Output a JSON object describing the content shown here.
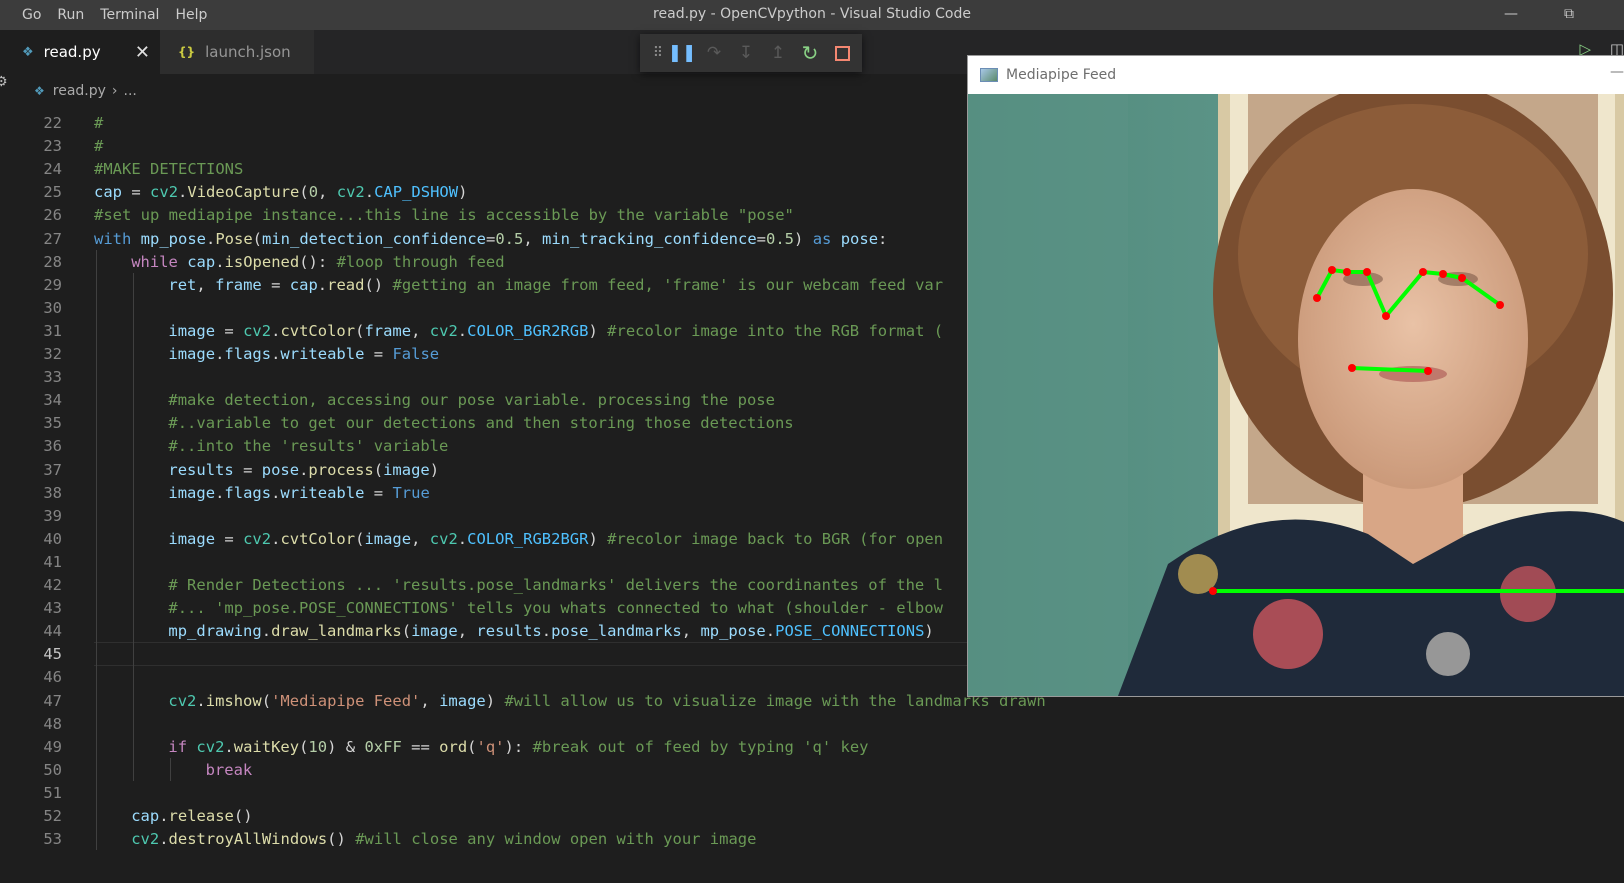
{
  "titlebar": {
    "menu": [
      "Go",
      "Run",
      "Terminal",
      "Help"
    ],
    "title": "read.py - OpenCVpython - Visual Studio Code"
  },
  "tabs": [
    {
      "label": "read.py",
      "icon": "python-file-icon",
      "active": true
    },
    {
      "label": "launch.json",
      "icon": "json-braces-icon",
      "active": false
    }
  ],
  "breadcrumb": {
    "file": "read.py",
    "rest": "..."
  },
  "code": {
    "active_line": 45,
    "lines": [
      {
        "n": "22",
        "text": "#"
      },
      {
        "n": "23",
        "text": "#"
      },
      {
        "n": "24",
        "text": "#MAKE DETECTIONS"
      },
      {
        "n": "25",
        "text": "cap = cv2.VideoCapture(0, cv2.CAP_DSHOW)"
      },
      {
        "n": "26",
        "text": "#set up mediapipe instance...this line is accessible by the variable \"pose\""
      },
      {
        "n": "27",
        "text": "with mp_pose.Pose(min_detection_confidence=0.5, min_tracking_confidence=0.5) as pose:"
      },
      {
        "n": "28",
        "text": "while cap.isOpened(): #loop through feed"
      },
      {
        "n": "29",
        "text": "ret, frame = cap.read() #getting an image from feed, 'frame' is our webcam feed var"
      },
      {
        "n": "30",
        "text": ""
      },
      {
        "n": "31",
        "text": "image = cv2.cvtColor(frame, cv2.COLOR_BGR2RGB) #recolor image into the RGB format ("
      },
      {
        "n": "32",
        "text": "image.flags.writeable = False"
      },
      {
        "n": "33",
        "text": ""
      },
      {
        "n": "34",
        "text": "#make detection, accessing our pose variable. processing the pose"
      },
      {
        "n": "35",
        "text": "#..variable to get our detections and then storing those detections"
      },
      {
        "n": "36",
        "text": "#..into the 'results' variable"
      },
      {
        "n": "37",
        "text": "results = pose.process(image)"
      },
      {
        "n": "38",
        "text": "image.flags.writeable = True"
      },
      {
        "n": "39",
        "text": ""
      },
      {
        "n": "40",
        "text": "image = cv2.cvtColor(image, cv2.COLOR_RGB2BGR) #recolor image back to BGR (for open"
      },
      {
        "n": "41",
        "text": ""
      },
      {
        "n": "42",
        "text": "# Render Detections ... 'results.pose_landmarks' delivers the coordinantes of the l"
      },
      {
        "n": "43",
        "text": "#... 'mp_pose.POSE_CONNECTIONS' tells you whats connected to what (shoulder - elbow"
      },
      {
        "n": "44",
        "text": "mp_drawing.draw_landmarks(image, results.pose_landmarks, mp_pose.POSE_CONNECTIONS)"
      },
      {
        "n": "45",
        "text": ""
      },
      {
        "n": "46",
        "text": ""
      },
      {
        "n": "47",
        "text": "cv2.imshow('Mediapipe Feed', image) #will allow us to visualize image with the landmarks drawn"
      },
      {
        "n": "48",
        "text": ""
      },
      {
        "n": "49",
        "text": "if cv2.waitKey(10) & 0xFF == ord('q'): #break out of feed by typing 'q' key"
      },
      {
        "n": "50",
        "text": "break"
      },
      {
        "n": "51",
        "text": ""
      },
      {
        "n": "52",
        "text": "cap.release()"
      },
      {
        "n": "53",
        "text": "cv2.destroyAllWindows() #will close any window open with your image"
      }
    ]
  },
  "mediapipe_window": {
    "title": "Mediapipe Feed",
    "landmark_color": "#00ff00",
    "point_color": "#ff0000"
  },
  "colors": {
    "keyword": "#569cd6",
    "control": "#c586c0",
    "variable": "#9cdcfe",
    "function": "#dcdcaa",
    "module": "#4ec9b0",
    "comment": "#6a9955",
    "number": "#b5cea8",
    "string": "#ce9178",
    "constant": "#4fc1ff"
  }
}
